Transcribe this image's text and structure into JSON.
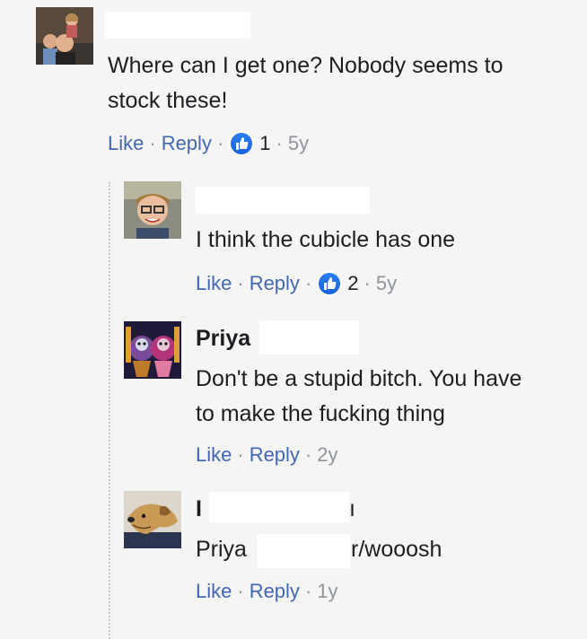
{
  "comments": [
    {
      "name": "",
      "text_lines": [
        "Where can I get one? Nobody seems to",
        "stock these!"
      ],
      "like_label": "Like",
      "reply_label": "Reply",
      "reactions": "1",
      "time": "5y",
      "avatar_icon": "family-photo-avatar"
    },
    {
      "name": "",
      "text_lines": [
        "I think the cubicle has one"
      ],
      "like_label": "Like",
      "reply_label": "Reply",
      "reactions": "2",
      "time": "5y",
      "avatar_icon": "boy-photo-avatar"
    },
    {
      "name": "Priya",
      "text_lines": [
        "Don't be a stupid bitch. You have",
        "to make the fucking thing"
      ],
      "like_label": "Like",
      "reply_label": "Reply",
      "time": "2y",
      "avatar_icon": "art-photo-avatar"
    },
    {
      "name_start": "I",
      "name_end": "ı",
      "text_prefix": "Priya",
      "text_suffix": "r/wooosh",
      "like_label": "Like",
      "reply_label": "Reply",
      "time": "1y",
      "avatar_icon": "dog-photo-avatar"
    }
  ],
  "colors": {
    "link": "#4267b2",
    "meta": "#90949c",
    "background": "#f5f5f5",
    "like_badge": "#1a62e0"
  },
  "separator": "·"
}
